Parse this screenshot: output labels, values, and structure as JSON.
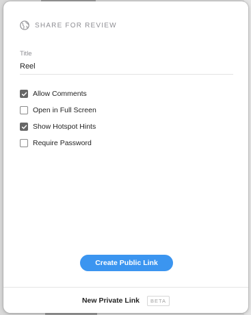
{
  "header": {
    "title": "SHARE FOR REVIEW",
    "icon": "globe-icon"
  },
  "form": {
    "title_label": "Title",
    "title_value": "Reel"
  },
  "options": [
    {
      "label": "Allow Comments",
      "checked": true
    },
    {
      "label": "Open in Full Screen",
      "checked": false
    },
    {
      "label": "Show Hotspot Hints",
      "checked": true
    },
    {
      "label": "Require Password",
      "checked": false
    }
  ],
  "actions": {
    "create_label": "Create Public Link"
  },
  "footer": {
    "link_label": "New Private Link",
    "badge": "BETA"
  },
  "colors": {
    "accent": "#3b95f0",
    "checkbox_checked": "#666666"
  }
}
